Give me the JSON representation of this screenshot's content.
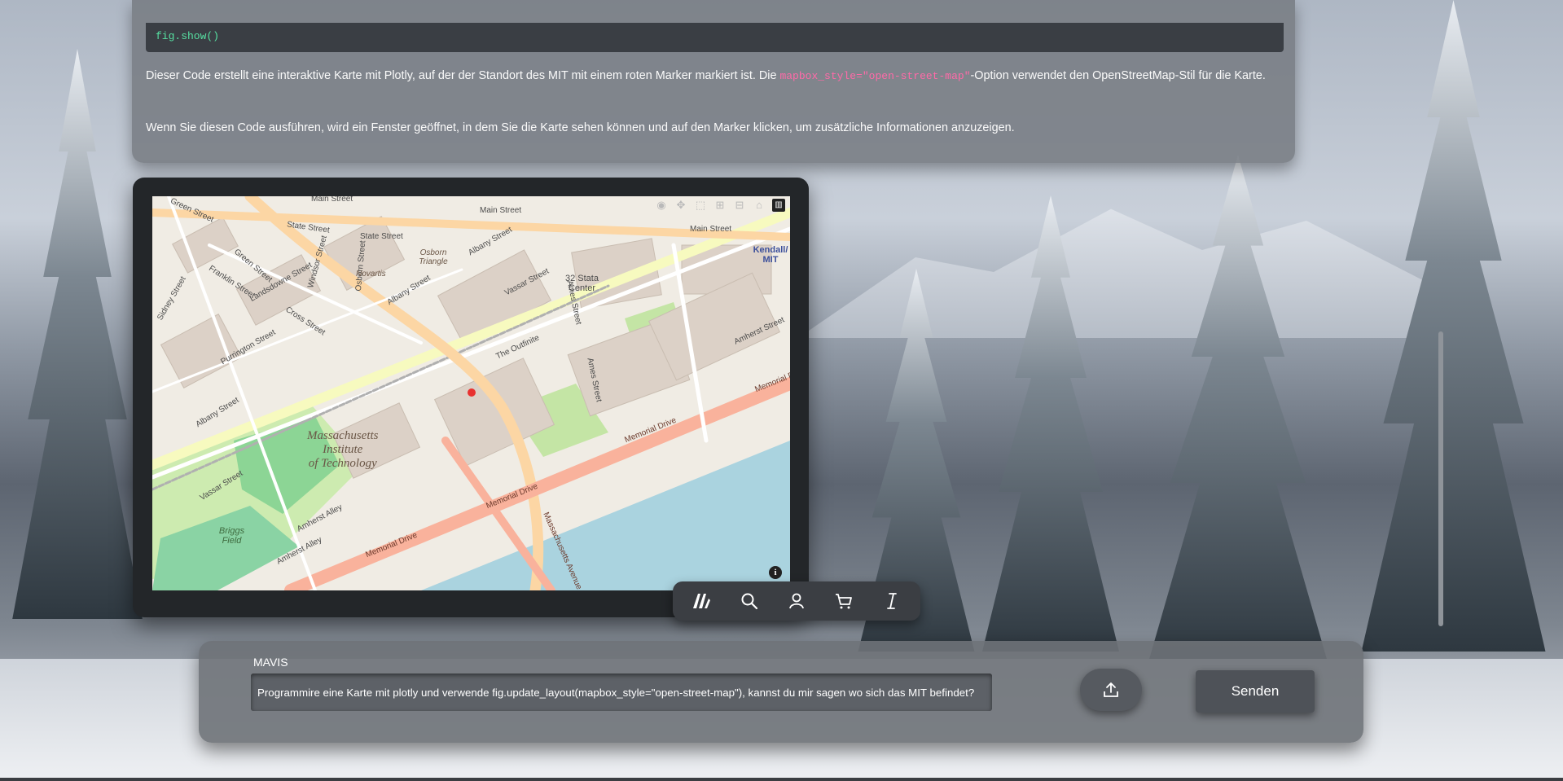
{
  "answer": {
    "code_tail": "fig.show()",
    "paragraph1_pre": "Dieser Code erstellt eine interaktive Karte mit Plotly, auf der der Standort des MIT mit einem roten Marker markiert ist. Die ",
    "paragraph1_code": "mapbox_style=\"open-street-map\"",
    "paragraph1_post": "-Option verwendet den OpenStreetMap-Stil für die Karte.",
    "paragraph2": "Wenn Sie diesen Code ausführen, wird ein Fenster geöffnet, in dem Sie die Karte sehen können und auf den Marker klicken, um zusätzliche Informationen anzuzeigen."
  },
  "map": {
    "place_label": "Massachusetts\nInstitute\nof Technology",
    "streets": [
      "Main Street",
      "Main Street",
      "Main Street",
      "State Street",
      "State Street",
      "Green Street",
      "Green Street",
      "Franklin Street",
      "Landsdowne Street",
      "Cross Street",
      "Purrington Street",
      "Albany Street",
      "Albany Street",
      "Albany Street",
      "Vassar Street",
      "Vassar Street",
      "Windsor Street",
      "Osborn Street",
      "Ames Street",
      "Ames Street",
      "Amherst Street",
      "Amherst Alley",
      "Amherst Alley",
      "Memorial Drive",
      "Memorial Drive",
      "Memorial Drive",
      "Memorial Drive",
      "Massachusetts Avenue",
      "Sidney Street",
      "The Outfinite"
    ],
    "places": [
      "32 Stata Center",
      "Kendall/ MIT",
      "Osborn Triangle",
      "Novartis",
      "Briggs Field"
    ],
    "marker_color": "#e8312f",
    "modebar_icons": [
      "camera-icon",
      "pan-icon",
      "zoom-box-icon",
      "zoom-in-icon",
      "zoom-out-icon",
      "reset-icon",
      "plotly-logo-icon"
    ]
  },
  "toolbar": {
    "items": [
      "logo-icon",
      "search-icon",
      "user-icon",
      "cart-icon",
      "text-cursor-icon"
    ]
  },
  "chat": {
    "label": "MAVIS",
    "input_value": "Programmire eine Karte mit plotly und verwende fig.update_layout(mapbox_style=\"open-street-map\"), kannst du mir sagen wo sich das MIT befindet?",
    "send_label": "Senden"
  }
}
